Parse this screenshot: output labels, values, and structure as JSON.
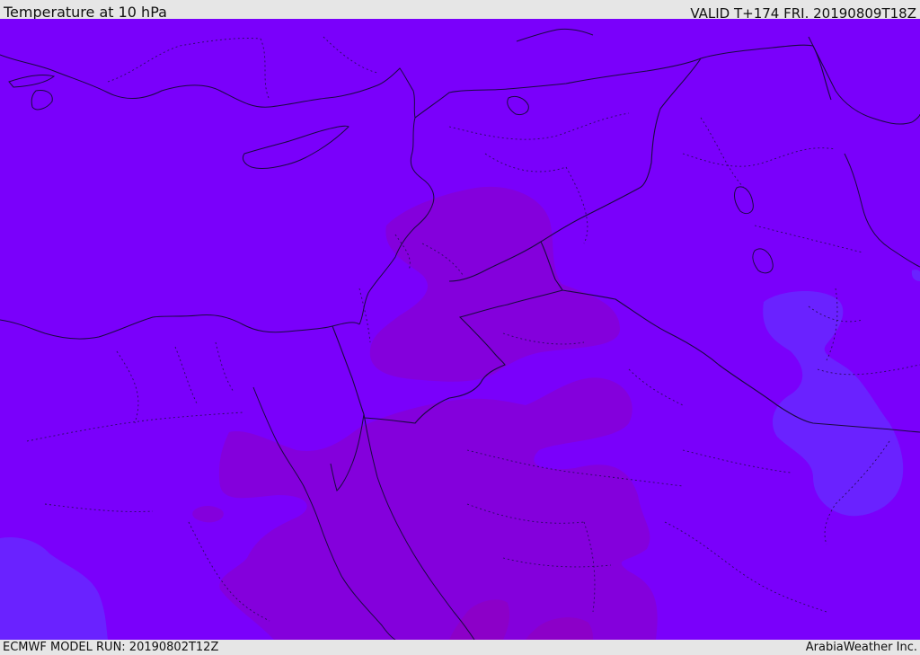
{
  "header": {
    "title": "Temperature at 10 hPa",
    "valid_time": "VALID T+174 FRI. 20190809T18Z"
  },
  "footer": {
    "model_run": "ECMWF MODEL RUN: 20190802T12Z",
    "credit": "ArabiaWeather Inc."
  },
  "colors": {
    "field_base": "#7a00fb",
    "field_warm": "#8400dc",
    "field_warmer": "#8c00c8",
    "field_cool": "#6a22ff",
    "coastline": "#1a0a40"
  }
}
